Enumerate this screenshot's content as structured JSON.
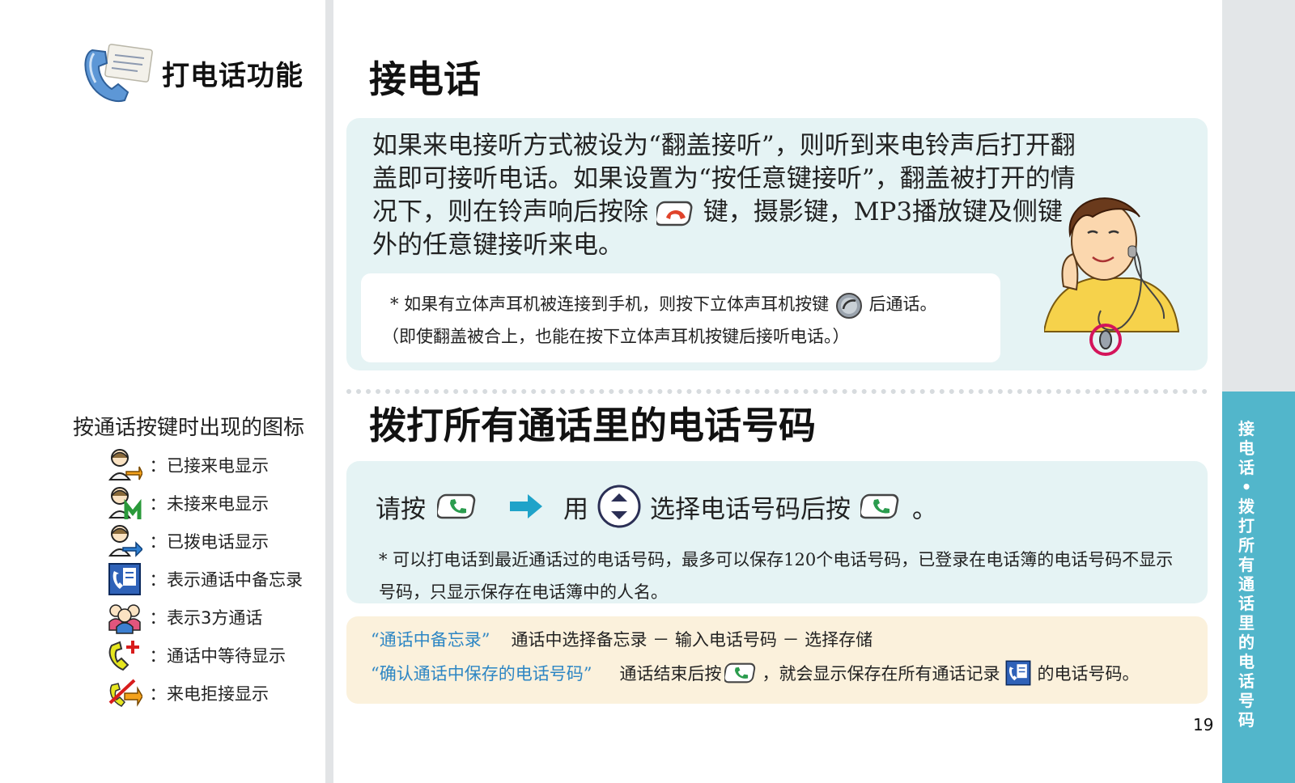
{
  "sidebar": {
    "title": "打电话功能",
    "icons_heading": "按通话按键时出现的图标",
    "legend": [
      {
        "icon": "received-call-icon",
        "colon": "：",
        "label": "已接来电显示"
      },
      {
        "icon": "missed-call-icon",
        "colon": "：",
        "label": "未接来电显示"
      },
      {
        "icon": "dialed-call-icon",
        "colon": "：",
        "label": "已拨电话显示"
      },
      {
        "icon": "call-memo-icon",
        "colon": "：",
        "label": "表示通话中备忘录"
      },
      {
        "icon": "three-way-call-icon",
        "colon": "：",
        "label": "表示3方通话"
      },
      {
        "icon": "call-waiting-icon",
        "colon": "：",
        "label": "通话中等待显示"
      },
      {
        "icon": "call-rejected-icon",
        "colon": "：",
        "label": "来电拒接显示"
      }
    ]
  },
  "section1": {
    "title": "接电话",
    "para_part1": "如果来电接听方式被设为“翻盖接听”，则听到来电铃声后打开翻盖即可接听电话。如果设置为“按任意键接听”，翻盖被打开的情况下，则在铃声响后按除",
    "para_part2": "键，摄影键，MP3播放键及侧键外的任意键接听来电。",
    "note_part1": "* 如果有立体声耳机被连接到手机，则按下立体声耳机按键",
    "note_part2": "后通话。",
    "note_line2": "（即使翻盖被合上，也能在按下立体声耳机按键后接听电话。）"
  },
  "section2": {
    "title": "拨打所有通话里的电话号码",
    "instr_press": "请按",
    "instr_use": "用",
    "instr_select": "选择电话号码后按",
    "instr_end": "。",
    "note": "* 可以打电话到最近通话过的电话号码，最多可以保存120个电话号码，已登录在电话簿的电话号码不显示号码，只显示保存在电话簿中的人名。"
  },
  "memo": {
    "row1_label": "“通话中备忘录”",
    "row1_text": "通话中选择备忘录 － 输入电话号码 － 选择存储",
    "row2_label": "“确认通话中保存的电话号码”",
    "row2_text1": "通话结束后按",
    "row2_text2": "，就会显示保存在所有通话记录",
    "row2_text3": "的电话号码。"
  },
  "side_tab": {
    "text": "接电话•拨打所有通话里的电话号码"
  },
  "page_number": "19",
  "colors": {
    "tab": "#52b6cb",
    "panel": "#e5f3f4",
    "memo_panel": "#fbf1dc",
    "accent_blue": "#2d86c4",
    "arrow": "#1fa3c9",
    "end_key": "#e0432b",
    "send_key": "#2b9c4e"
  }
}
